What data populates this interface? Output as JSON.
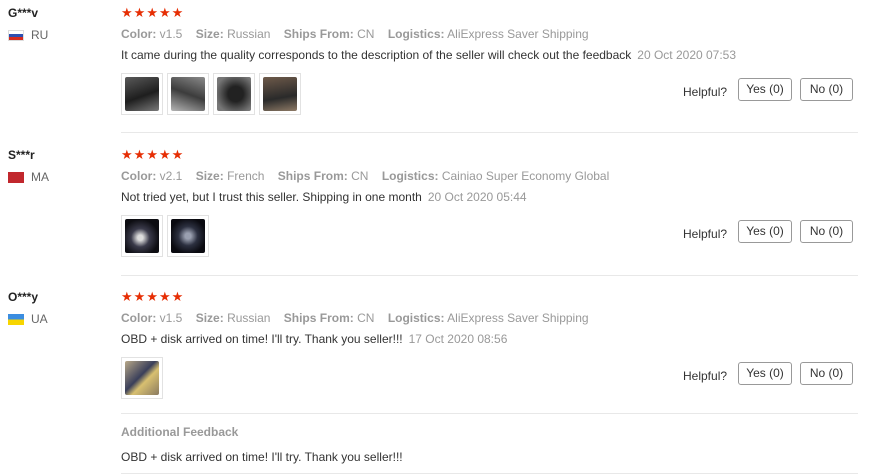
{
  "labels": {
    "color": "Color:",
    "size": "Size:",
    "ships_from": "Ships From:",
    "logistics": "Logistics:",
    "helpful": "Helpful?",
    "additional_feedback": "Additional Feedback"
  },
  "colors": {
    "star": "#e62e04",
    "muted": "#999999"
  },
  "reviews": [
    {
      "user": "G***v",
      "country": "RU",
      "rating": 5,
      "color": "v1.5",
      "size": "Russian",
      "ships_from": "CN",
      "logistics": "AliExpress Saver Shipping",
      "text": "It came during the quality corresponds to the description of the seller will check out the feedback",
      "date": "20 Oct 2020 07:53",
      "photos": 4,
      "yes": "Yes (0)",
      "no": "No (0)"
    },
    {
      "user": "S***r",
      "country": "MA",
      "rating": 5,
      "color": "v2.1",
      "size": "French",
      "ships_from": "CN",
      "logistics": "Cainiao Super Economy Global",
      "text": "Not tried yet, but I trust this seller. Shipping in one month",
      "date": "20 Oct 2020 05:44",
      "photos": 2,
      "yes": "Yes (0)",
      "no": "No (0)"
    },
    {
      "user": "O***y",
      "country": "UA",
      "rating": 5,
      "color": "v1.5",
      "size": "Russian",
      "ships_from": "CN",
      "logistics": "AliExpress Saver Shipping",
      "text": "OBD + disk arrived on time! I'll try. Thank you seller!!!",
      "date": "17 Oct 2020 08:56",
      "photos": 1,
      "yes": "Yes (0)",
      "no": "No (0)",
      "additional_text": "OBD + disk arrived on time! I'll try. Thank you seller!!!"
    }
  ]
}
